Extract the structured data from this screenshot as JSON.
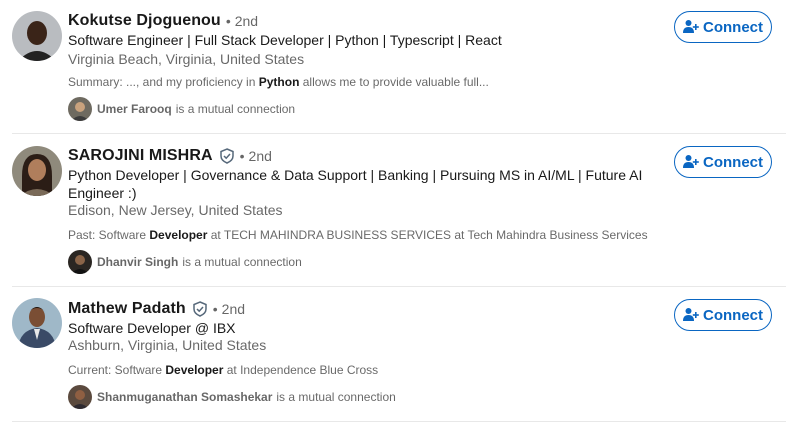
{
  "results": [
    {
      "name": "Kokutse Djoguenou",
      "verified": false,
      "degree": "2nd",
      "headline": "Software Engineer | Full Stack Developer | Python | Typescript | React",
      "location": "Virginia Beach, Virginia, United States",
      "summary_pre": "Summary: ..., and my proficiency in ",
      "summary_bold": "Python",
      "summary_post": " allows me to provide valuable full...",
      "mutual_name": "Umer Farooq",
      "mutual_text": "is a mutual connection",
      "connect_label": "Connect"
    },
    {
      "name": "SAROJINI MISHRA",
      "verified": true,
      "degree": "2nd",
      "headline": "Python Developer | Governance & Data Support | Banking | Pursuing MS in AI/ML | Future AI Engineer :)",
      "location": "Edison, New Jersey, United States",
      "summary_pre": "Past: Software ",
      "summary_bold": "Developer",
      "summary_post": " at TECH MAHINDRA BUSINESS SERVICES at Tech Mahindra Business Services",
      "mutual_name": "Dhanvir Singh",
      "mutual_text": "is a mutual connection",
      "connect_label": "Connect"
    },
    {
      "name": "Mathew Padath",
      "verified": true,
      "degree": "2nd",
      "headline": "Software Developer @ IBX",
      "location": "Ashburn, Virginia, United States",
      "summary_pre": "Current: Software ",
      "summary_bold": "Developer",
      "summary_post": " at Independence Blue Cross",
      "mutual_name": "Shanmuganathan Somashekar",
      "mutual_text": "is a mutual connection",
      "connect_label": "Connect"
    }
  ],
  "colors": {
    "brand": "#0a66c2",
    "text_primary": "rgba(0,0,0,0.9)",
    "text_secondary": "rgba(0,0,0,0.6)",
    "divider": "#e8e8e8"
  },
  "icons": {
    "verified": "verified-shield-icon",
    "connect": "add-person-icon",
    "degree_separator": "•"
  }
}
